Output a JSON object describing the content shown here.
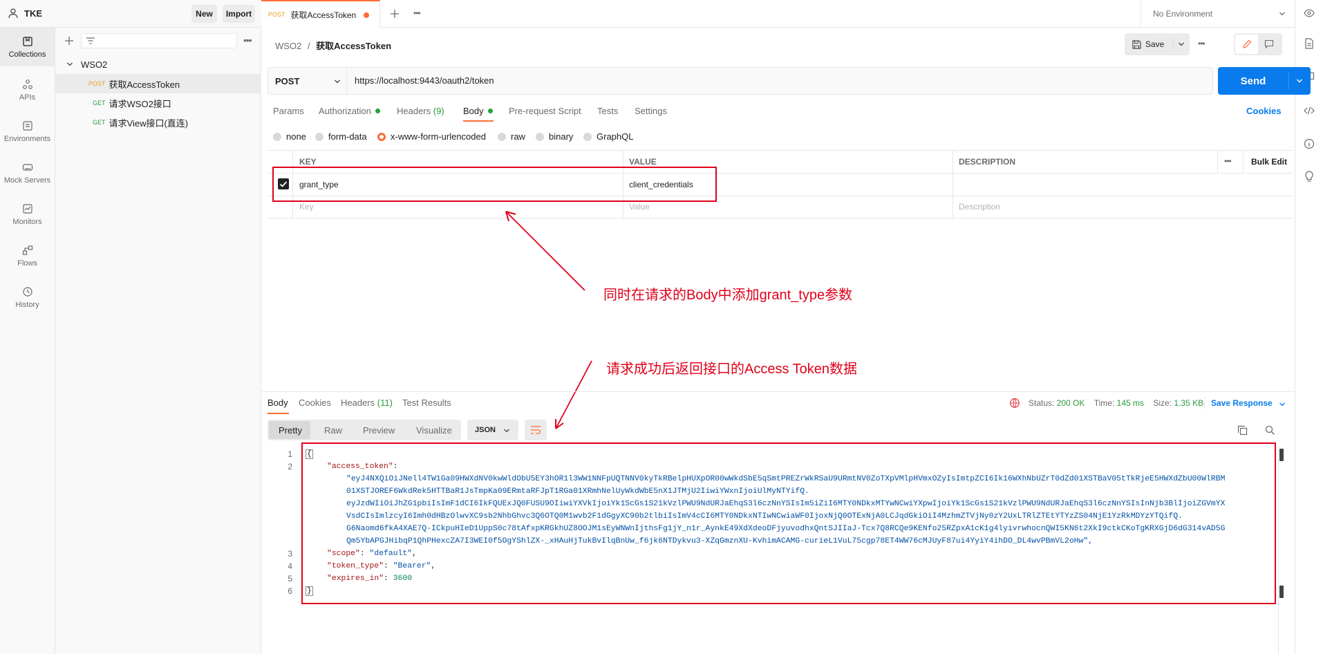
{
  "workspace": {
    "name": "TKE",
    "new_label": "New",
    "import_label": "Import"
  },
  "rail": [
    {
      "label": "Collections",
      "icon": "collections-icon"
    },
    {
      "label": "APIs",
      "icon": "apis-icon"
    },
    {
      "label": "Environments",
      "icon": "environments-icon"
    },
    {
      "label": "Mock Servers",
      "icon": "mock-servers-icon"
    },
    {
      "label": "Monitors",
      "icon": "monitors-icon"
    },
    {
      "label": "Flows",
      "icon": "flows-icon"
    },
    {
      "label": "History",
      "icon": "history-icon"
    }
  ],
  "tree": {
    "collection": "WSO2",
    "requests": [
      {
        "method": "POST",
        "name": "获取AccessToken"
      },
      {
        "method": "GET",
        "name": "请求WSO2接口"
      },
      {
        "method": "GET",
        "name": "请求View接口(直连)"
      }
    ]
  },
  "tab": {
    "method": "POST",
    "title": "获取AccessToken"
  },
  "environment": "No Environment",
  "breadcrumb": {
    "parent": "WSO2",
    "separator": "/",
    "current": "获取AccessToken"
  },
  "toolbar": {
    "save_label": "Save"
  },
  "request": {
    "method": "POST",
    "url": "https://localhost:9443/oauth2/token",
    "send_label": "Send",
    "tabs": {
      "params": "Params",
      "authorization": "Authorization",
      "headers": "Headers",
      "headers_count": "(9)",
      "body": "Body",
      "prerequest": "Pre-request Script",
      "tests": "Tests",
      "settings": "Settings"
    },
    "cookies_label": "Cookies",
    "body_modes": [
      "none",
      "form-data",
      "x-www-form-urlencoded",
      "raw",
      "binary",
      "GraphQL"
    ],
    "body_mode_selected": "x-www-form-urlencoded",
    "table": {
      "headers": {
        "key": "KEY",
        "value": "VALUE",
        "description": "DESCRIPTION",
        "bulk_edit": "Bulk Edit"
      },
      "rows": [
        {
          "key": "grant_type",
          "value": "client_credentials",
          "description": "",
          "checked": true
        }
      ],
      "placeholders": {
        "key": "Key",
        "value": "Value",
        "description": "Description"
      }
    }
  },
  "annotations": {
    "body_note": "同时在请求的Body中添加grant_type参数",
    "response_note": "请求成功后返回接口的Access Token数据",
    "color": "#e0001a"
  },
  "response": {
    "tabs": {
      "body": "Body",
      "cookies": "Cookies",
      "headers": "Headers",
      "headers_count": "(11)",
      "test_results": "Test Results"
    },
    "status_label": "Status:",
    "status_value": "200 OK",
    "time_label": "Time:",
    "time_value": "145 ms",
    "size_label": "Size:",
    "size_value": "1.35 KB",
    "save_response_label": "Save Response",
    "views": [
      "Pretty",
      "Raw",
      "Preview",
      "Visualize"
    ],
    "format": "JSON",
    "json": {
      "open": "{",
      "access_token_key": "\"access_token\"",
      "token_lines": [
        "\"eyJ4NXQiOiJNell4TW1Ga09HWXdNV0kwWldObU5EY3hOR1l3WW1NNFpUQTNNV0kyTkRBelpHUXpOR00wWkdSbE5qSmtPREZrWkRSaU9URmtNV0ZoTXpVMlpHVmxOZyIsImtpZCI6Ik16WXhNbUZrT0dZd01XSTBaV05tTkRjeE5HWXdZbU00WlRBM",
        "01XSTJOREF6WkdRek5HTTBaR1JsTmpKa09ERmtaRFJpT1RGa01XRmhNelUyWkdWbE5nX1JTMjU2IiwiYWxnIjoiUlMyNTYifQ.",
        "eyJzdWIiOiJhZG1pbiIsImF1dCI6IkFQUExJQ0FUSU9OIiwiYXVkIjoiYk1ScGs1S21kVzlPWU9NdURJaEhqS3l6czNnYSIsIm5iZiI6MTY0NDkxMTYwNCwiYXpwIjoiYk1ScGs1S21kVzlPWU9NdURJaEhqS3l6czNnYSIsInNjb3BlIjoiZGVmYX",
        "VsdCIsImlzcyI6Imh0dHBzOlwvXC9sb2NhbGhvc3Q6OTQ0M1wvb2F1dGgyXC90b2tlbiIsImV4cCI6MTY0NDkxNTIwNCwiaWF0IjoxNjQ0OTExNjA0LCJqdGkiOiI4MzhmZTVjNy0zY2UxLTRlZTEtYTYzZS04NjE1YzRkMDYzYTQifQ.",
        "G6Naomd6fkA4XAE7Q-ICkpuHIeD1UppS0c78tAfxpKRGkhUZ8OOJM1sEyWNWnIjthsFg1jY_n1r_AynkE49XdXdeoDFjyuvodhxQntSJIIaJ-Tcx7Q8RCQe9KENfo25RZpxA1cK1g4lyivrwhocnQWI5KN6t2XkI9ctkCKoTgKRXGjD6dG314vAD5G",
        "Qm5YbAPGJHibqP1QhPHexcZA7I3WEI0f5OgYShlZX-_xHAuHjTukBvIlqBnUw_f6jk6NTDykvu3-XZqGmznXU-KvhimACAMG-curieL1VuL75cgp78ET4WW76cMJUyF87ui4YyiY4ihDO_DL4wvPBmVL2oHw\","
      ],
      "scope_key": "\"scope\"",
      "scope_value": "\"default\"",
      "token_type_key": "\"token_type\"",
      "token_type_value": "\"Bearer\"",
      "expires_in_key": "\"expires_in\"",
      "expires_in_value": "3600",
      "close": "}"
    },
    "line_numbers": [
      "1",
      "2",
      "3",
      "4",
      "5",
      "6"
    ]
  }
}
